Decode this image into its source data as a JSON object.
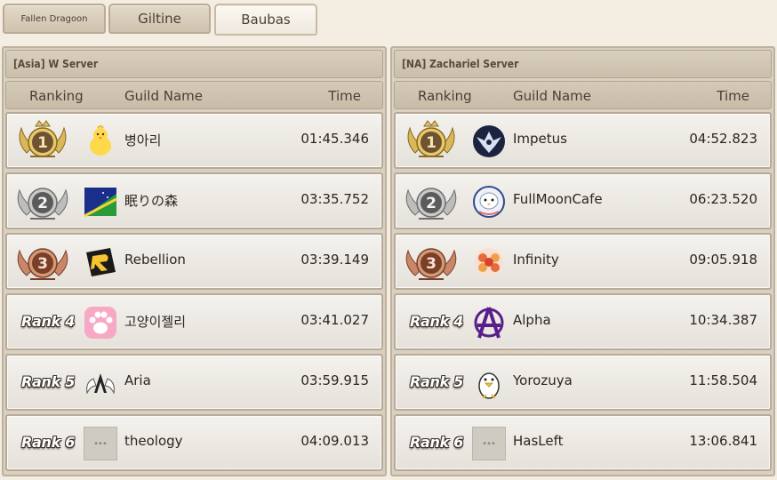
{
  "tabs": [
    {
      "label": "Fallen Dragoon",
      "active": false
    },
    {
      "label": "Giltine",
      "active": false
    },
    {
      "label": "Baubas",
      "active": true
    }
  ],
  "columns": {
    "ranking": "Ranking",
    "guild": "Guild Name",
    "time": "Time"
  },
  "servers": [
    {
      "title": "[Asia] W Server",
      "rows": [
        {
          "rank": "1",
          "medal": "gold",
          "guild": "병아리",
          "time": "01:45.346",
          "emblem": "chick-emblem-icon"
        },
        {
          "rank": "2",
          "medal": "silver",
          "guild": "眠りの森",
          "time": "03:35.752",
          "emblem": "moon-flag-emblem-icon"
        },
        {
          "rank": "3",
          "medal": "bronze",
          "guild": "Rebellion",
          "time": "03:39.149",
          "emblem": "rebellion-emblem-icon"
        },
        {
          "rank": "Rank 4",
          "medal": "none",
          "guild": "고양이젤리",
          "time": "03:41.027",
          "emblem": "paw-emblem-icon"
        },
        {
          "rank": "Rank 5",
          "medal": "none",
          "guild": "Aria",
          "time": "03:59.915",
          "emblem": "wings-emblem-icon"
        },
        {
          "rank": "Rank 6",
          "medal": "none",
          "guild": "theology",
          "time": "04:09.013",
          "emblem": "placeholder-emblem-icon"
        }
      ]
    },
    {
      "title": "[NA] Zachariel Server",
      "rows": [
        {
          "rank": "1",
          "medal": "gold",
          "guild": "Impetus",
          "time": "04:52.823",
          "emblem": "phoenix-emblem-icon"
        },
        {
          "rank": "2",
          "medal": "silver",
          "guild": "FullMoonCafe",
          "time": "06:23.520",
          "emblem": "bird-emblem-icon"
        },
        {
          "rank": "3",
          "medal": "bronze",
          "guild": "Infinity",
          "time": "09:05.918",
          "emblem": "flower-emblem-icon"
        },
        {
          "rank": "Rank 4",
          "medal": "none",
          "guild": "Alpha",
          "time": "10:34.387",
          "emblem": "anarchy-emblem-icon"
        },
        {
          "rank": "Rank 5",
          "medal": "none",
          "guild": "Yorozuya",
          "time": "11:58.504",
          "emblem": "penguin-emblem-icon"
        },
        {
          "rank": "Rank 6",
          "medal": "none",
          "guild": "HasLeft",
          "time": "13:06.841",
          "emblem": "placeholder-emblem-icon"
        }
      ]
    }
  ],
  "colors": {
    "gold": "#c9a64a",
    "silver": "#a8a8a8",
    "bronze": "#b5704b",
    "background": "#f3ede2"
  }
}
